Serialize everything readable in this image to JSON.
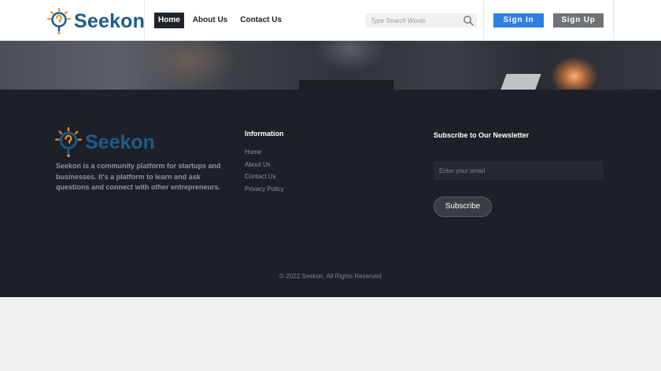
{
  "header": {
    "logo_text": "Seekon",
    "nav": [
      "Home",
      "About Us",
      "Contact Us"
    ],
    "search_placeholder": "Type Search Words",
    "signin_label": "Sign In",
    "signup_label": "Sign Up"
  },
  "footer": {
    "logo_text": "Seekon",
    "description": "Seekon is a community platform for startups and businesses. It's a platform to learn and ask questions and connect with other entrepreneurs.",
    "information_title": "Information",
    "links": [
      "Home",
      "About Us",
      "Contact Us",
      "Privacy Policy"
    ],
    "newsletter_title": "Subscribe to Our Newsletter",
    "email_placeholder": "Enter your email",
    "subscribe_label": "Subscribe",
    "copyright": "© 2022 Seekon. All Rights Reserved"
  },
  "colors": {
    "brand_blue": "#1c5c8a",
    "brand_orange": "#f08a24",
    "signin_blue": "#2f7fe3",
    "signup_gray": "#6f7277",
    "footer_bg": "#1e2027"
  },
  "icons": {
    "logo": "lightbulb-question-icon",
    "search": "search-icon"
  }
}
